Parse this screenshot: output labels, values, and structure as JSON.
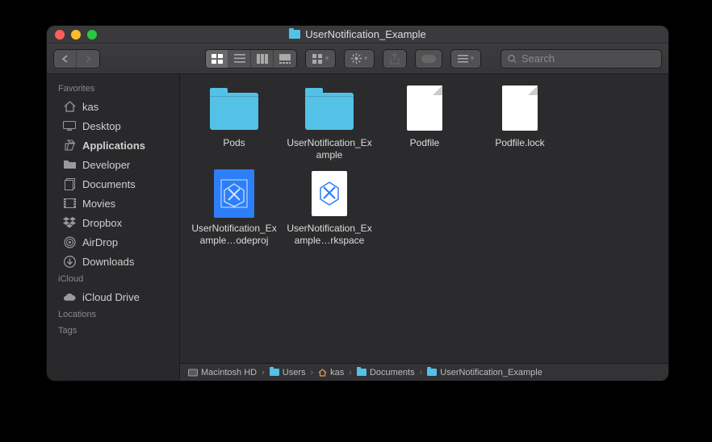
{
  "window": {
    "title": "UserNotification_Example"
  },
  "search": {
    "placeholder": "Search",
    "value": ""
  },
  "sidebar": {
    "sections": [
      {
        "header": "Favorites",
        "items": [
          {
            "icon": "home-icon",
            "label": "kas",
            "bold": false
          },
          {
            "icon": "desktop-icon",
            "label": "Desktop",
            "bold": false
          },
          {
            "icon": "apps-icon",
            "label": "Applications",
            "bold": true
          },
          {
            "icon": "folder-icon",
            "label": "Developer",
            "bold": false
          },
          {
            "icon": "documents-icon",
            "label": "Documents",
            "bold": false
          },
          {
            "icon": "movies-icon",
            "label": "Movies",
            "bold": false
          },
          {
            "icon": "dropbox-icon",
            "label": "Dropbox",
            "bold": false
          },
          {
            "icon": "airdrop-icon",
            "label": "AirDrop",
            "bold": false
          },
          {
            "icon": "downloads-icon",
            "label": "Downloads",
            "bold": false
          }
        ]
      },
      {
        "header": "iCloud",
        "items": [
          {
            "icon": "cloud-icon",
            "label": "iCloud Drive",
            "bold": false
          }
        ]
      },
      {
        "header": "Locations",
        "items": []
      },
      {
        "header": "Tags",
        "items": []
      }
    ]
  },
  "files": [
    {
      "type": "folder",
      "label": "Pods"
    },
    {
      "type": "folder",
      "label": "UserNotification_Example"
    },
    {
      "type": "doc",
      "label": "Podfile"
    },
    {
      "type": "doc",
      "label": "Podfile.lock"
    },
    {
      "type": "xcodeproj",
      "label": "UserNotification_Example…odeproj"
    },
    {
      "type": "xcworkspace",
      "label": "UserNotification_Example…rkspace"
    }
  ],
  "pathbar": [
    {
      "icon": "disk-icon",
      "label": "Macintosh HD"
    },
    {
      "icon": "mini-folder",
      "label": "Users"
    },
    {
      "icon": "home-mini-icon",
      "label": "kas"
    },
    {
      "icon": "mini-folder",
      "label": "Documents"
    },
    {
      "icon": "mini-folder",
      "label": "UserNotification_Example"
    }
  ]
}
